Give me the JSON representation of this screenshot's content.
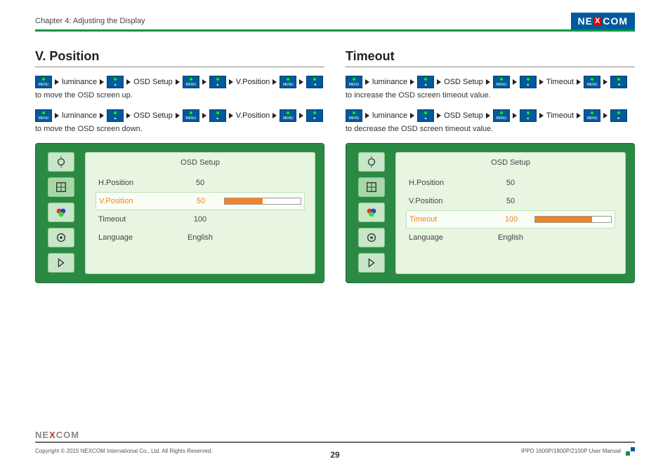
{
  "header": {
    "chapter": "Chapter 4: Adjusting the Display",
    "brand_pre": "NE",
    "brand_mid": "X",
    "brand_post": "COM"
  },
  "left": {
    "title": "V. Position",
    "crumb1": {
      "a": "luminance",
      "b": "OSD Setup",
      "c": "V.Position"
    },
    "caption1": "to move the OSD screen up.",
    "crumb2": {
      "a": "luminance",
      "b": "OSD Setup",
      "c": "V.Position"
    },
    "caption2": "to move the OSD screen down.",
    "osd": {
      "header": "OSD Setup",
      "rows": {
        "hpos": {
          "label": "H.Position",
          "value": "50"
        },
        "vpos": {
          "label": "V.Position",
          "value": "50"
        },
        "timeout": {
          "label": "Timeout",
          "value": "100"
        },
        "lang": {
          "label": "Language",
          "value": "English"
        }
      }
    }
  },
  "right": {
    "title": "Timeout",
    "crumb1": {
      "a": "luminance",
      "b": "OSD Setup",
      "c": "Timeout"
    },
    "caption1": "to increase the OSD screen timeout value.",
    "crumb2": {
      "a": "luminance",
      "b": "OSD Setup",
      "c": "Timeout"
    },
    "caption2": "to decrease the OSD screen timeout value.",
    "osd": {
      "header": "OSD Setup",
      "rows": {
        "hpos": {
          "label": "H.Position",
          "value": "50"
        },
        "vpos": {
          "label": "V.Position",
          "value": "50"
        },
        "timeout": {
          "label": "Timeout",
          "value": "100"
        },
        "lang": {
          "label": "Language",
          "value": "English"
        }
      }
    }
  },
  "buttons": {
    "menu": "MENU",
    "up": "▲",
    "down": "▼",
    "left": "◄",
    "right": "►"
  },
  "footer": {
    "brand_pre": "NE",
    "brand_mid": "X",
    "brand_post": "COM",
    "copyright": "Copyright © 2015 NEXCOM International Co., Ltd. All Rights Reserved.",
    "page": "29",
    "manual": "IPPD 1600P/1800P/2100P User Manual"
  }
}
